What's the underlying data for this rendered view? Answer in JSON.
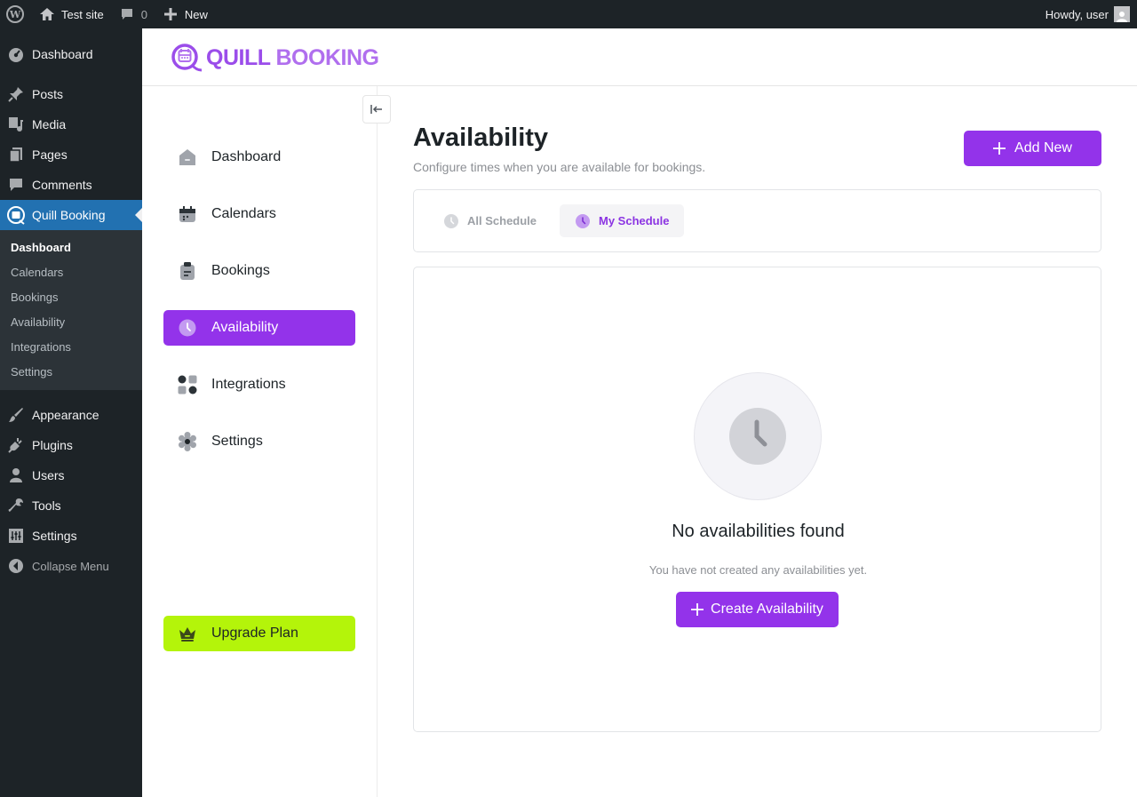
{
  "adminbar": {
    "site_name": "Test site",
    "comments_count": "0",
    "new_label": "New",
    "greeting": "Howdy, user"
  },
  "wp_menu": {
    "items": [
      {
        "label": "Dashboard",
        "icon": "dashboard-icon"
      },
      {
        "label": "Posts",
        "icon": "pin-icon"
      },
      {
        "label": "Media",
        "icon": "media-icon"
      },
      {
        "label": "Pages",
        "icon": "pages-icon"
      },
      {
        "label": "Comments",
        "icon": "comment-icon"
      },
      {
        "label": "Quill Booking",
        "icon": "quill-booking-icon",
        "active": true
      },
      {
        "label": "Appearance",
        "icon": "brush-icon"
      },
      {
        "label": "Plugins",
        "icon": "plug-icon"
      },
      {
        "label": "Users",
        "icon": "user-icon"
      },
      {
        "label": "Tools",
        "icon": "wrench-icon"
      },
      {
        "label": "Settings",
        "icon": "sliders-icon"
      },
      {
        "label": "Collapse Menu",
        "icon": "collapse-arrow-icon"
      }
    ],
    "submenu": [
      "Dashboard",
      "Calendars",
      "Bookings",
      "Availability",
      "Integrations",
      "Settings"
    ]
  },
  "brand": {
    "logo_word1": "QUILL",
    "logo_word2": "BOOKING",
    "accent": "#9333ea",
    "upgrade_color": "#b4f40a"
  },
  "quill_nav": {
    "items": [
      {
        "label": "Dashboard",
        "icon": "home-icon"
      },
      {
        "label": "Calendars",
        "icon": "calendar-icon"
      },
      {
        "label": "Bookings",
        "icon": "clipboard-icon"
      },
      {
        "label": "Availability",
        "icon": "clock-icon",
        "active": true
      },
      {
        "label": "Integrations",
        "icon": "grid-dots-icon"
      },
      {
        "label": "Settings",
        "icon": "gear-icon"
      }
    ],
    "upgrade_label": "Upgrade Plan"
  },
  "page": {
    "title": "Availability",
    "subtitle": "Configure times when you are available for bookings.",
    "add_new_label": "Add New"
  },
  "tabs": [
    {
      "label": "All Schedule",
      "selected": false
    },
    {
      "label": "My Schedule",
      "selected": true
    }
  ],
  "empty_state": {
    "title": "No availabilities found",
    "text": "You have not created any availabilities yet.",
    "button_label": "Create Availability"
  }
}
